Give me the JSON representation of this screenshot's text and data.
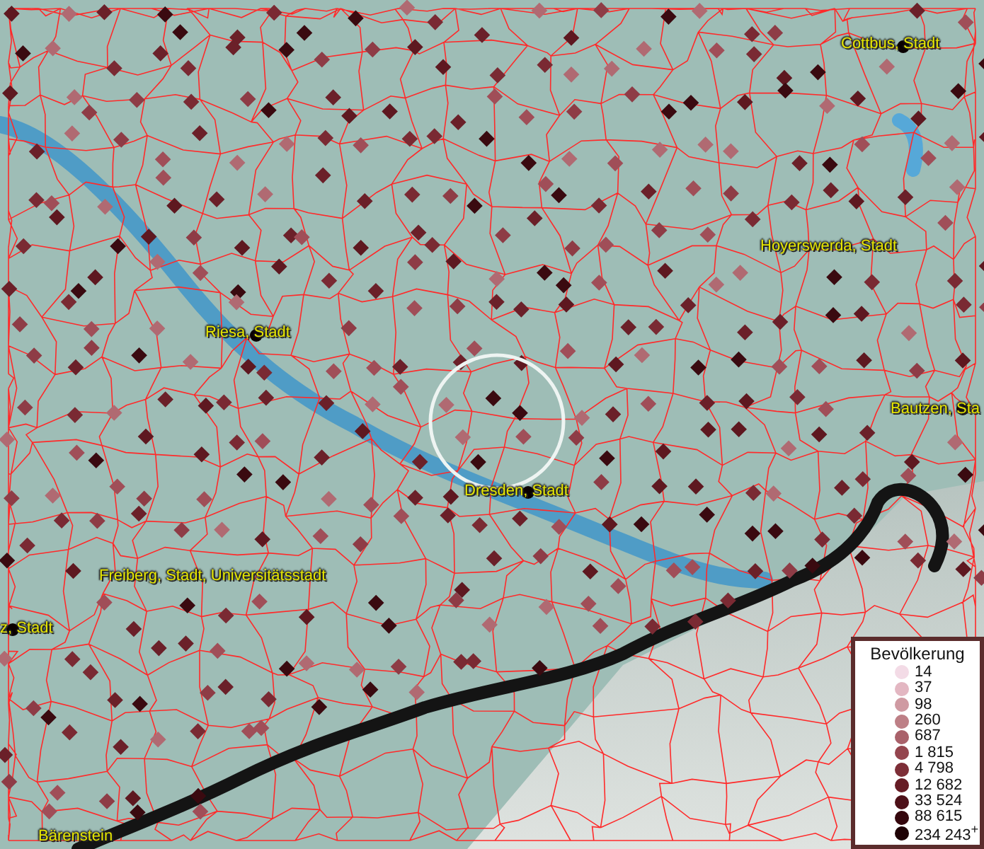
{
  "map": {
    "places": [
      {
        "name": "Cottbus, Stadt",
        "marker": true
      },
      {
        "name": "Hoyerswerda, Stadt",
        "marker": false
      },
      {
        "name": "Riesa, Stadt",
        "marker": true
      },
      {
        "name": "Bautzen, Sta",
        "marker": true
      },
      {
        "name": "Dresden, Stadt",
        "marker": true
      },
      {
        "name": "Freiberg, Stadt, Universitätsstadt",
        "marker": false
      },
      {
        "name": "z, Stadt",
        "marker": true
      },
      {
        "name": "Bärenstein",
        "marker": false
      }
    ]
  },
  "legend": {
    "title": "Bevölkerung",
    "entries": [
      {
        "label": "14",
        "color": "#f3dbe6"
      },
      {
        "label": "37",
        "color": "#e3b7c2"
      },
      {
        "label": "98",
        "color": "#cf9aa2"
      },
      {
        "label": "260",
        "color": "#bd7f86"
      },
      {
        "label": "687",
        "color": "#a9616a"
      },
      {
        "label": "1 815",
        "color": "#94454e"
      },
      {
        "label": "4 798",
        "color": "#7d2e37"
      },
      {
        "label": "12 682",
        "color": "#661c25"
      },
      {
        "label": "33 524",
        "color": "#4d1018"
      },
      {
        "label": "88 615",
        "color": "#35070d"
      },
      {
        "label": "234 243$^{+}$",
        "color": "#1f0205"
      }
    ]
  }
}
